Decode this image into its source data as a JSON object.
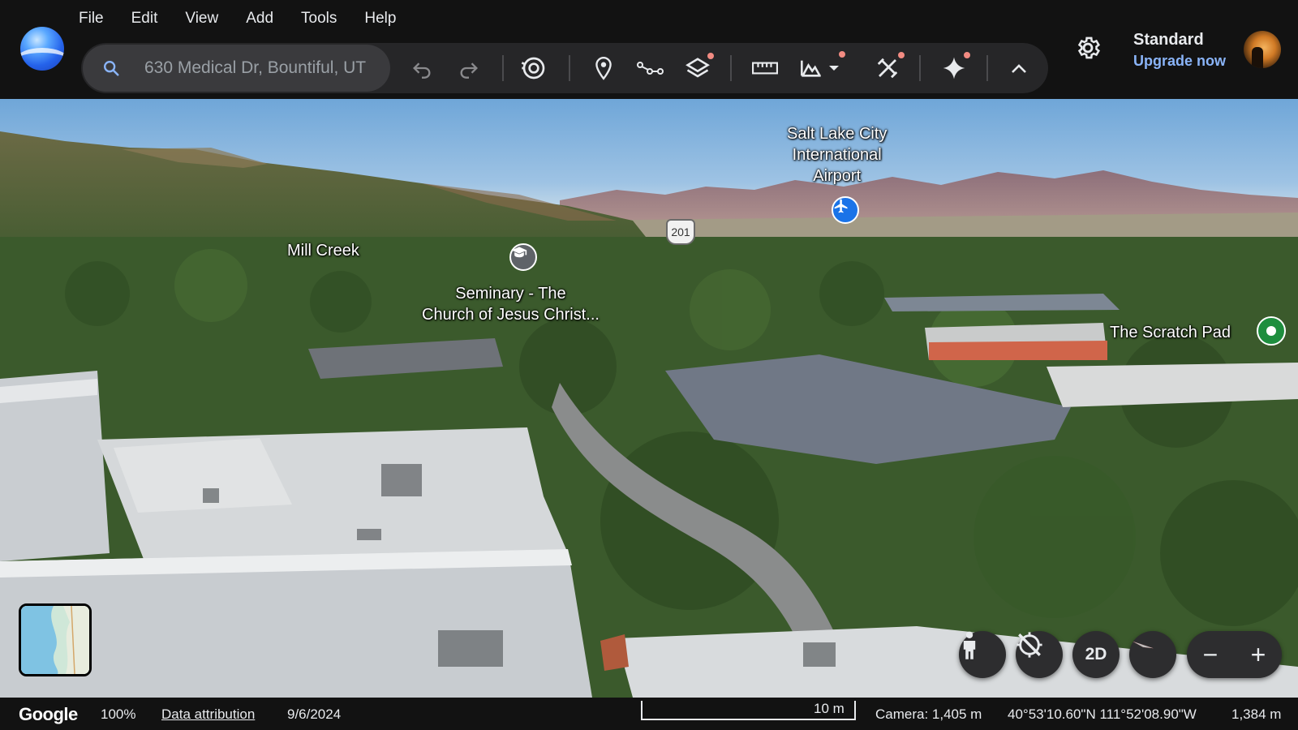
{
  "menu": {
    "items": [
      "File",
      "Edit",
      "View",
      "Add",
      "Tools",
      "Help"
    ]
  },
  "search": {
    "value": "630 Medical Dr, Bountiful, UT",
    "icon": "search-icon"
  },
  "toolbar": {
    "icons": [
      "undo-icon",
      "redo-icon",
      "history-icon",
      "placemark-icon",
      "path-icon",
      "layers-icon",
      "measure-icon",
      "terrain-icon",
      "chevron-down-icon",
      "tools-icon",
      "ai-sparkle-icon",
      "collapse-chevron-up-icon"
    ],
    "notification_color": "#f28b82"
  },
  "account": {
    "plan": "Standard",
    "upgrade_label": "Upgrade now",
    "upgrade_color": "#8ab4f8"
  },
  "map": {
    "labels": {
      "airport_line1": "Salt Lake City",
      "airport_line2": "International",
      "airport_line3": "Airport",
      "mill_creek": "Mill Creek",
      "seminary_line1": "Seminary - The",
      "seminary_line2": "Church of Jesus Christ...",
      "scratch_pad": "The Scratch Pad",
      "route_shield": "201"
    },
    "pin_colors": {
      "airport": "#1a73e8",
      "scratch_pad": "#1e8e3e",
      "seminary": "#5f6368"
    }
  },
  "controls": {
    "mode_2d_label": "2D",
    "zoom_out": "−",
    "zoom_in": "+"
  },
  "status": {
    "brand": "Google",
    "zoom": "100%",
    "attribution": "Data attribution",
    "date": "9/6/2024",
    "scale": "10 m",
    "camera": "Camera: 1,405 m",
    "coords": "40°53'10.60\"N 111°52'08.90\"W",
    "elevation": "1,384 m"
  }
}
